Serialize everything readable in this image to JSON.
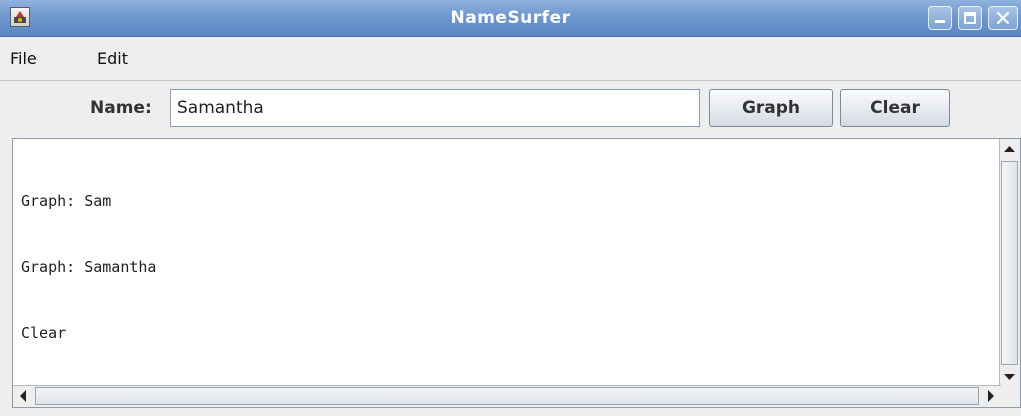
{
  "window": {
    "title": "NameSurfer",
    "icon": "java-app-icon",
    "controls": [
      "minimize-icon",
      "maximize-icon",
      "close-icon"
    ]
  },
  "menubar": {
    "items": [
      {
        "label": "File"
      },
      {
        "label": "Edit"
      }
    ]
  },
  "controls": {
    "name_label": "Name:",
    "name_value": "Samantha",
    "graph_label": "Graph",
    "clear_label": "Clear"
  },
  "log": {
    "lines": [
      "Graph: Sam",
      "Graph: Samantha",
      "Clear"
    ]
  },
  "colors": {
    "titlebar": "#6f98cf",
    "background": "#eeeeee",
    "text": "#333333"
  }
}
